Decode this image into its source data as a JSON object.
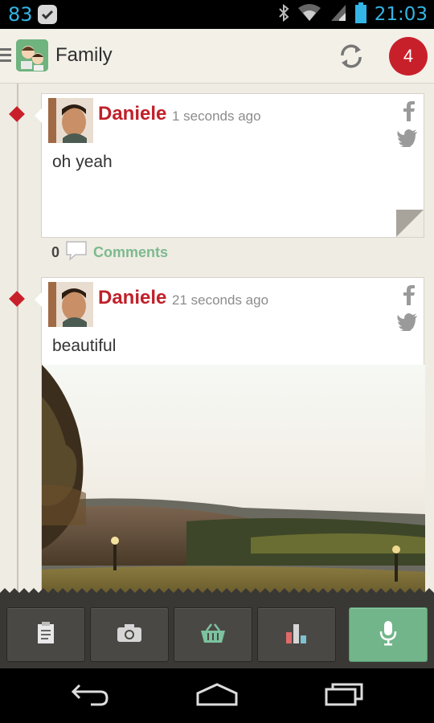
{
  "status_bar": {
    "battery_level": "83",
    "time": "21:03",
    "icons": [
      "bluetooth-icon",
      "wifi-icon",
      "signal-icon",
      "battery-icon"
    ]
  },
  "app_bar": {
    "title": "Family",
    "notification_count": "4"
  },
  "posts": [
    {
      "author": "Daniele",
      "time_ago": "1 seconds ago",
      "text": "oh yeah",
      "comments_count": "0",
      "comments_label": "Comments"
    },
    {
      "author": "Daniele",
      "time_ago": "21 seconds ago",
      "text": "beautiful"
    }
  ],
  "action_bar": {
    "buttons": [
      "note-icon",
      "camera-icon",
      "basket-icon",
      "chart-icon",
      "microphone-icon"
    ]
  },
  "colors": {
    "accent": "#c0202a",
    "comments": "#7cba8e",
    "mic_button": "#72b58a",
    "status_blue": "#33b5e5"
  }
}
